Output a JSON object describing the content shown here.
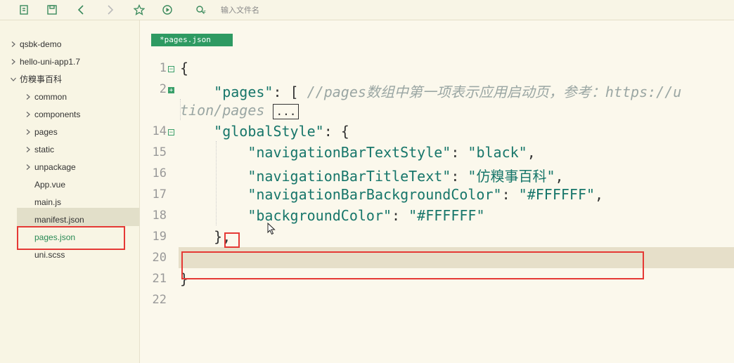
{
  "toolbar": {
    "icons": [
      "new-file-icon",
      "save-icon",
      "back-icon",
      "forward-icon",
      "star-icon",
      "run-icon",
      "search-file-icon"
    ],
    "search_placeholder": "输入文件名"
  },
  "sidebar": {
    "projects": [
      {
        "label": "qsbk-demo"
      },
      {
        "label": "hello-uni-app1.7"
      },
      {
        "label": "仿糗事百科"
      }
    ],
    "children": [
      {
        "label": "common"
      },
      {
        "label": "components"
      },
      {
        "label": "pages"
      },
      {
        "label": "static"
      },
      {
        "label": "unpackage"
      },
      {
        "label": "App.vue"
      },
      {
        "label": "main.js"
      },
      {
        "label": "manifest.json"
      },
      {
        "label": "pages.json"
      },
      {
        "label": "uni.scss"
      }
    ]
  },
  "editor": {
    "tab_label": "*pages.json",
    "line_numbers": [
      "1",
      "2",
      "14",
      "15",
      "16",
      "17",
      "18",
      "19",
      "20",
      "21",
      "22"
    ],
    "lines": {
      "l1": "{",
      "l2_key": "\"pages\"",
      "l2_rest": ": [ ",
      "l2_comment": "//pages数组中第一项表示应用启动页，参考：https://u",
      "l2b_comment": "tion/pages ",
      "l2b_fold": "...",
      "l14_key": "\"globalStyle\"",
      "l14_rest": ": {",
      "l15_key": "\"navigationBarTextStyle\"",
      "l15_val": "\"black\"",
      "l16_key": "\"navigationBarTitleText\"",
      "l16_val": "\"仿糗事百科\"",
      "l17_key": "\"navigationBarBackgroundColor\"",
      "l17_val": "\"#FFFFFF\"",
      "l18_key": "\"backgroundColor\"",
      "l18_val": "\"#FFFFFF\"",
      "l19": "},",
      "l21": "}"
    }
  },
  "colors": {
    "accent": "#2e9a62",
    "annotation": "#e53935",
    "string": "#17766a"
  }
}
